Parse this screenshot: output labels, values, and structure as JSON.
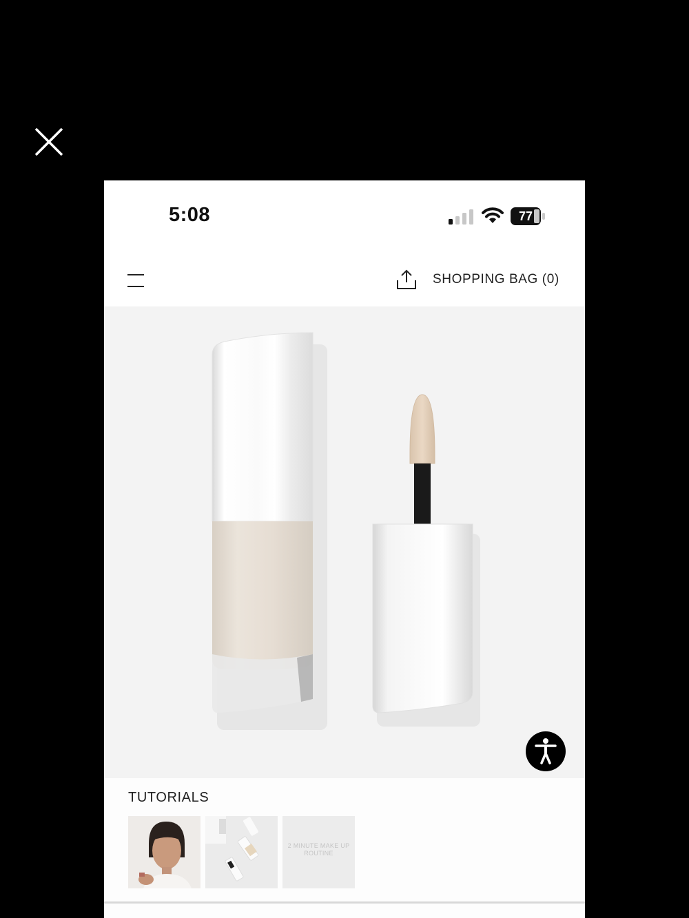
{
  "status_bar": {
    "time": "5:08",
    "battery": "77"
  },
  "nav": {
    "shopping_bag_label": "SHOPPING BAG (0)"
  },
  "tutorials": {
    "title": "TUTORIALS",
    "thumbnails": [
      {
        "caption": ""
      },
      {
        "caption": ""
      },
      {
        "caption": "2 MINUTE MAKE UP ROUTINE"
      }
    ]
  },
  "colors": {
    "page_background": "#000000",
    "screen_background": "#ffffff",
    "product_background": "#f3f3f3",
    "concealer_shade": "#e7dfd4",
    "accent": "#000000"
  },
  "icons": [
    "close-icon",
    "signal-icon",
    "wifi-icon",
    "battery-icon",
    "menu-icon",
    "share-icon",
    "accessibility-icon"
  ]
}
